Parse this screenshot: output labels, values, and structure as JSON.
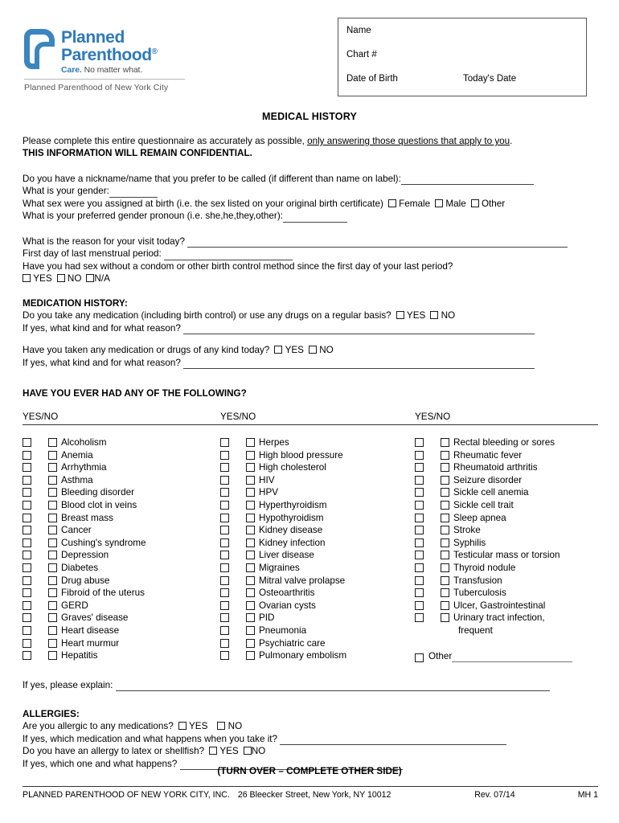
{
  "logo": {
    "word1": "Planned",
    "word2": "Parenthood",
    "registered": "®",
    "tagline_bold": "Care.",
    "tagline_rest": " No matter what.",
    "affiliate": "Planned Parenthood of New York City",
    "brand_color": "#2e7ab8"
  },
  "id_box": {
    "name_label": "Name",
    "chart_label": "Chart #",
    "dob_label": "Date of Birth",
    "today_label": "Today's Date"
  },
  "title": "MEDICAL HISTORY",
  "intro": {
    "line1_a": "Please complete this entire questionnaire as accurately as possible, ",
    "line1_underlined": "only answering those questions that apply to you",
    "line1_b": ".",
    "line2": "THIS INFORMATION WILL REMAIN CONFIDENTIAL."
  },
  "demographics": {
    "nickname_q": "Do you have a nickname/name that you prefer to be called (if different than name on label):",
    "gender_q": "What is your gender:",
    "sex_at_birth_q": "What sex were you assigned at birth (i.e. the sex listed on your original birth certificate)",
    "sex_options": [
      "Female",
      "Male",
      "Other"
    ],
    "pronoun_q": "What is your preferred gender pronoun (i.e. she,he,they,other):"
  },
  "visit": {
    "reason_q": "What is the reason for your visit today?",
    "lmp_q": "First day of last menstrual period:",
    "unprotected_q": "Have you had sex without a condom or other birth control method since the first day of your last period?",
    "options": [
      "YES",
      "NO",
      "N/A"
    ]
  },
  "medication": {
    "heading": "MEDICATION HISTORY:",
    "q1": "Do you take any medication (including birth control) or use any drugs on a regular basis?",
    "q1_options": [
      "YES",
      "NO"
    ],
    "q1_followup": "If yes, what kind and for what reason?",
    "q2": "Have you taken any medication or drugs of any kind today?",
    "q2_options": [
      "YES",
      "NO"
    ],
    "q2_followup": "If yes, what kind and for what reason?"
  },
  "conditions": {
    "heading": "HAVE YOU EVER HAD ANY OF THE FOLLOWING?",
    "column_headers": [
      "YES/NO",
      "YES/NO",
      "YES/NO"
    ],
    "col1": [
      "Alcoholism",
      "Anemia",
      "Arrhythmia",
      "Asthma",
      "Bleeding disorder",
      "Blood clot in veins",
      "Breast mass",
      "Cancer",
      "Cushing's syndrome",
      "Depression",
      "Diabetes",
      "Drug abuse",
      "Fibroid of the uterus",
      "GERD",
      "Graves' disease",
      "Heart disease",
      "Heart murmur",
      "Hepatitis"
    ],
    "col2": [
      "Herpes",
      "High blood pressure",
      "High cholesterol",
      "HIV",
      "HPV",
      "Hyperthyroidism",
      "Hypothyroidism",
      "Kidney disease",
      "Kidney infection",
      "Liver disease",
      "Migraines",
      "Mitral valve prolapse",
      "Osteoarthritis",
      "Ovarian cysts",
      "PID",
      "Pneumonia",
      "Psychiatric care",
      "Pulmonary embolism"
    ],
    "col3": [
      "Rectal bleeding or sores",
      "Rheumatic fever",
      "Rheumatoid arthritis",
      "Seizure disorder",
      "Sickle cell anemia",
      "Sickle cell trait",
      "Sleep apnea",
      "Stroke",
      "Syphilis",
      "Testicular mass or torsion",
      "Thyroid nodule",
      "Transfusion",
      "Tuberculosis",
      "Ulcer, Gastrointestinal",
      "Urinary tract infection,"
    ],
    "col3_continuation": "frequent",
    "other_label": "Other"
  },
  "explain": {
    "label": "If yes, please explain:"
  },
  "allergies": {
    "heading": "ALLERGIES:",
    "q1": "Are you allergic to any medications?",
    "q1_options": [
      "YES",
      "NO"
    ],
    "q1_followup": "If yes, which medication and what happens when you take it?",
    "q2": "Do you have an allergy to latex or shellfish?",
    "q2_options": [
      "YES",
      "NO"
    ],
    "q2_followup": "If yes, which one and what happens?"
  },
  "turnover_notice": "(TURN OVER – COMPLETE OTHER SIDE)",
  "footer": {
    "org": "PLANNED PARENTHOOD OF NEW YORK CITY, INC.",
    "address": "26 Bleecker Street, New York, NY 10012",
    "revision": "Rev. 07/14",
    "code": "MH 1"
  }
}
